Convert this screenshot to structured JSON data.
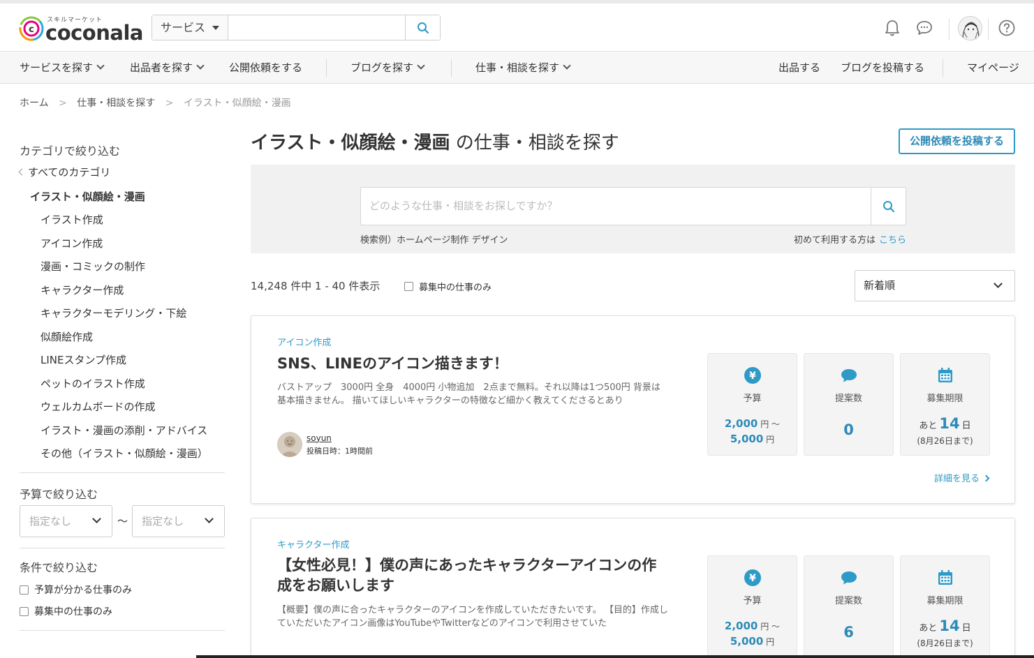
{
  "header": {
    "logo_tagline": "スキルマーケット",
    "logo_text": "coconala",
    "search_category": "サービス",
    "search_value": ""
  },
  "nav": {
    "items": [
      {
        "label": "サービスを探す"
      },
      {
        "label": "出品者を探す"
      },
      {
        "label": "公開依頼をする"
      },
      {
        "label": "ブログを探す"
      },
      {
        "label": "仕事・相談を探す"
      }
    ],
    "right": [
      {
        "label": "出品する"
      },
      {
        "label": "ブログを投稿する"
      },
      {
        "label": "マイページ"
      }
    ]
  },
  "breadcrumb": {
    "items": [
      "ホーム",
      "仕事・相談を探す",
      "イラスト・似顔絵・漫画"
    ],
    "separator": ">"
  },
  "sidebar": {
    "category_heading": "カテゴリで絞り込む",
    "all_categories": "すべてのカテゴリ",
    "current_category": "イラスト・似顔絵・漫画",
    "subcategories": [
      "イラスト作成",
      "アイコン作成",
      "漫画・コミックの制作",
      "キャラクター作成",
      "キャラクターモデリング・下絵",
      "似顔絵作成",
      "LINEスタンプ作成",
      "ペットのイラスト作成",
      "ウェルカムボードの作成",
      "イラスト・漫画の添削・アドバイス",
      "その他（イラスト・似顔絵・漫画）"
    ],
    "budget_heading": "予算で絞り込む",
    "budget_min": "指定なし",
    "budget_tilde": "〜",
    "budget_max": "指定なし",
    "condition_heading": "条件で絞り込む",
    "conditions": [
      {
        "label": "予算が分かる仕事のみ",
        "checked": false
      },
      {
        "label": "募集中の仕事のみ",
        "checked": false
      }
    ]
  },
  "main": {
    "title_bold": "イラスト・似顔絵・漫画",
    "title_rest": " の仕事・相談を探す",
    "post_button": "公開依頼を投稿する",
    "search_placeholder": "どのような仕事・相談をお探しですか？",
    "search_example": "検索例）ホームページ制作 デザイン",
    "first_time": "初めて利用する方は",
    "first_time_link": "こちら",
    "result_count": "14,248 件中 1 - 40 件表示",
    "recruit_only_label": "募集中の仕事のみ",
    "sort_value": "新着順"
  },
  "stat_labels": {
    "budget": "予算",
    "proposals": "提案数",
    "deadline": "募集期限",
    "deadline_prefix": "あと",
    "deadline_unit": "日",
    "yen_unit": "円",
    "range_sep": "〜"
  },
  "cards": [
    {
      "category": "アイコン作成",
      "title": "SNS、LINEのアイコン描きます！",
      "description": "バストアップ　3000円 全身　4000円 小物追加　2点まで無料。それ以降は1つ500円 背景は基本描きません。 描いてほしいキャラクターの特徴など細かく教えてくださるとあり",
      "budget_min": "2,000",
      "budget_max": "5,000",
      "proposals": "0",
      "days_left": "14",
      "deadline_date": "(8月26日まで)",
      "poster_name": "soyun",
      "posted_at": "投稿日時：1時間前",
      "detail_link": "詳細を見る"
    },
    {
      "category": "キャラクター作成",
      "title": "【女性必見！】僕の声にあったキャラクターアイコンの作成をお願いします",
      "description": "【概要】僕の声に合ったキャラクターのアイコンを作成していただきたいです。 【目的】作成していただいたアイコン画像はYouTubeやTwitterなどのアイコンで利用させていた",
      "budget_min": "2,000",
      "budget_max": "5,000",
      "proposals": "6",
      "days_left": "14",
      "deadline_date": "(8月26日まで)"
    }
  ],
  "colors": {
    "accent": "#2d9ac7",
    "logo_orange": "#f39800",
    "logo_green": "#8cc63f",
    "logo_blue": "#2ea7e0"
  }
}
